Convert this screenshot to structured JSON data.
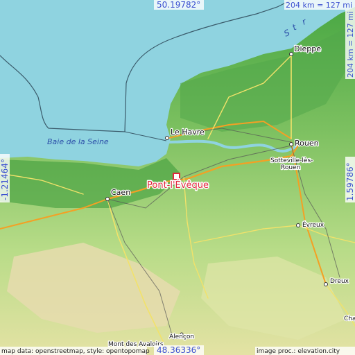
{
  "featured_place": {
    "name": "Pont-l'Évêque",
    "marker_color": "#e0283c"
  },
  "coordinates": {
    "north": "50.19782°",
    "south": "48.36336°",
    "west": "-1.21464°",
    "east": "1.59786°"
  },
  "scale": {
    "horizontal": "204 km = 127 mi",
    "vertical": "204 km = 127 mi"
  },
  "water_labels": {
    "bay": "Baie de la Seine",
    "strait_letters": [
      "S",
      "t",
      "r"
    ]
  },
  "cities": {
    "dieppe": "Dieppe",
    "le_havre": "Le Havre",
    "rouen": "Rouen",
    "sotteville_line1": "Sotteville-lès-",
    "sotteville_line2": "Rouen",
    "caen": "Caen",
    "evreux": "Évreux",
    "dreux": "Dreux",
    "alencon": "Alençon",
    "mont_des_avaloirs": "Mont des Avaloirs",
    "cha_partial": "Cha"
  },
  "attribution": {
    "left": "map data: openstreetmap, style: opentopomap",
    "right": "image proc.: elevation.city"
  },
  "colors": {
    "sea": "#8fd3e0",
    "lowland": "#4caa46",
    "midland": "#8cc870",
    "upland": "#d8e8a8",
    "highland": "#e8d8a8",
    "road_major": "#f4a024",
    "road_minor": "#f2e26a",
    "rail": "#555555"
  }
}
